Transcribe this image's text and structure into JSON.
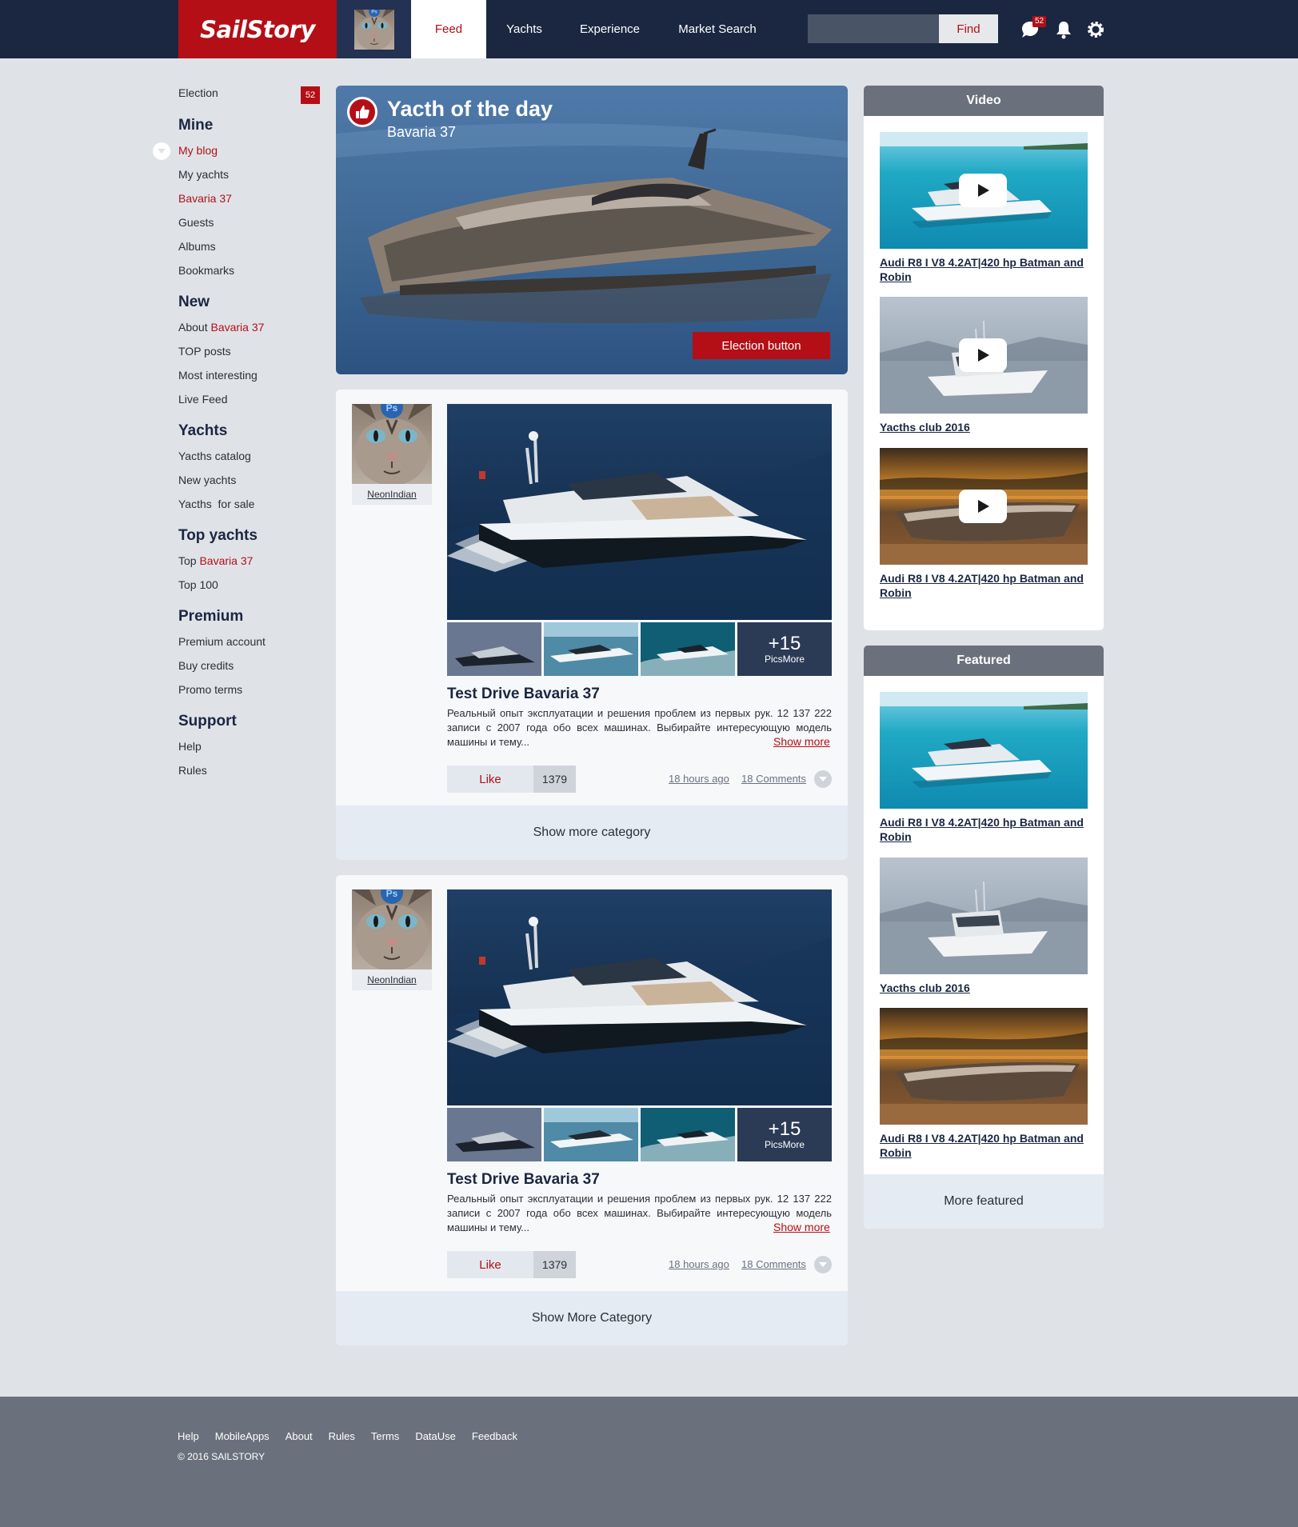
{
  "header": {
    "logo": "SailStory",
    "nav": [
      {
        "label": "Feed",
        "active": true
      },
      {
        "label": "Yachts",
        "active": false
      },
      {
        "label": "Experience",
        "active": false
      },
      {
        "label": "Market Search",
        "active": false
      }
    ],
    "search": {
      "value": "",
      "placeholder": ""
    },
    "find_label": "Find",
    "messages_badge": "52",
    "icons": [
      "chat-icon",
      "bell-icon",
      "gear-icon"
    ]
  },
  "sidebar": {
    "election_label": "Election",
    "election_badge": "52",
    "sections": [
      {
        "title": "Mine",
        "items": [
          {
            "label": "My blog",
            "active": true
          },
          {
            "label": "My yachts"
          },
          {
            "label": "Bavaria 37",
            "red": true
          },
          {
            "label": "Guests"
          },
          {
            "label": "Albums"
          },
          {
            "label": "Bookmarks"
          }
        ]
      },
      {
        "title": "New",
        "items": [
          {
            "prefix": "About ",
            "red_part": "Bavaria 37"
          },
          {
            "label": "TOP posts"
          },
          {
            "label": "Most interesting"
          },
          {
            "label": "Live Feed"
          }
        ]
      },
      {
        "title": "Yachts",
        "items": [
          {
            "label": "Yacths catalog"
          },
          {
            "label": "New yachts"
          },
          {
            "label": "Yacths  for sale"
          }
        ]
      },
      {
        "title": "Top yachts",
        "items": [
          {
            "prefix": "Top ",
            "red_part": "Bavaria 37"
          },
          {
            "label": "Top 100"
          }
        ]
      },
      {
        "title": "Premium",
        "items": [
          {
            "label": "Premium account"
          },
          {
            "label": "Buy credits"
          },
          {
            "label": "Promo terms"
          }
        ]
      },
      {
        "title": "Support",
        "items": [
          {
            "label": "Help"
          },
          {
            "label": "Rules"
          }
        ]
      }
    ]
  },
  "hero": {
    "title": "Yacth of the day",
    "subtitle": "Bavaria 37",
    "button": "Election button"
  },
  "posts": [
    {
      "author": "NeonIndian",
      "more_count": "+15",
      "more_label": "PicsMore",
      "title": "Test Drive Bavaria 37",
      "text": "Реальный опыт эксплуатации и решения проблем из первых рук. 12 137 222 записи с 2007 года обо всех машинах. Выбирайте интересующую модель машины и тему...",
      "show_more": "Show more",
      "like": "Like",
      "likes": "1379",
      "time": "18 hours ago",
      "comments": "18 Comments",
      "footer": "Show more category"
    },
    {
      "author": "NeonIndian",
      "more_count": "+15",
      "more_label": "PicsMore",
      "title": "Test Drive Bavaria 37",
      "text": "Реальный опыт эксплуатации и решения проблем из первых рук. 12 137 222 записи с 2007 года обо всех машинах. Выбирайте интересующую модель машины и тему...",
      "show_more": "Show more",
      "like": "Like",
      "likes": "1379",
      "time": "18 hours ago",
      "comments": "18 Comments",
      "footer": "Show More Category"
    }
  ],
  "video": {
    "title": "Video",
    "items": [
      {
        "title": "Audi R8 I V8 4.2AT|420 hp Batman and Robin"
      },
      {
        "title": "Yacths club 2016"
      },
      {
        "title": "Audi R8 I V8 4.2AT|420 hp Batman and Robin"
      }
    ]
  },
  "featured": {
    "title": "Featured",
    "items": [
      {
        "title": "Audi R8 I V8 4.2AT|420 hp Batman and Robin"
      },
      {
        "title": "Yacths club 2016"
      },
      {
        "title": "Audi R8 I V8 4.2AT|420 hp Batman and Robin"
      }
    ],
    "more": "More featured"
  },
  "footer": {
    "links": [
      "Help",
      "MobileApps",
      "About",
      "Rules",
      "Terms",
      "DataUse",
      "Feedback"
    ],
    "copyright": "© 2016 SAILSTORY"
  },
  "colors": {
    "brand": "#b40f16",
    "header": "#1b2741",
    "footer": "#6b717c"
  }
}
